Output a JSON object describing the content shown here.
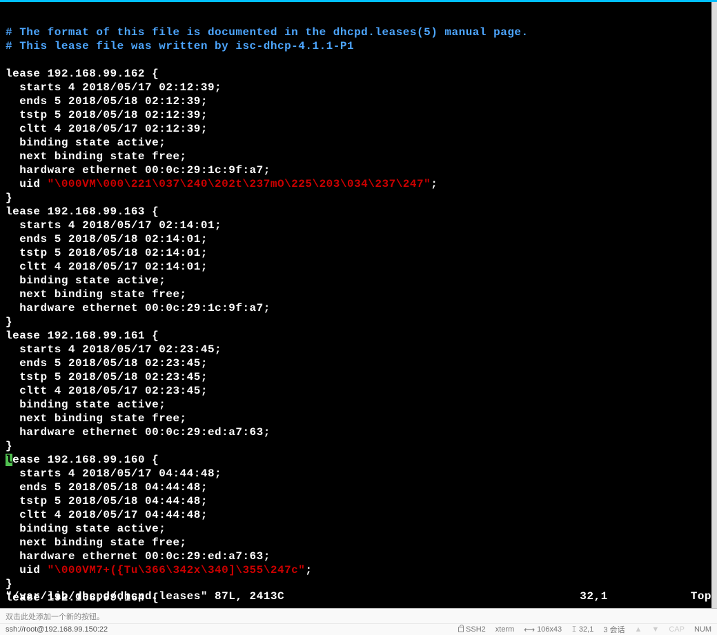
{
  "comments": {
    "line1": "# The format of this file is documented in the dhcpd.leases(5) manual page.",
    "line2": "# This lease file was written by isc-dhcp-4.1.1-P1"
  },
  "leases": [
    {
      "header": "lease 192.168.99.162 {",
      "starts": "  starts 4 2018/05/17 02:12:39;",
      "ends": "  ends 5 2018/05/18 02:12:39;",
      "tstp": "  tstp 5 2018/05/18 02:12:39;",
      "cltt": "  cltt 4 2018/05/17 02:12:39;",
      "binding": "  binding state active;",
      "next": "  next binding state free;",
      "hw": "  hardware ethernet 00:0c:29:1c:9f:a7;",
      "uid_prefix": "  uid ",
      "uid_val": "\"\\000VM\\000\\221\\037\\240\\202t\\237mO\\225\\203\\034\\237\\247\"",
      "uid_suffix": ";",
      "close": "}"
    },
    {
      "header": "lease 192.168.99.163 {",
      "starts": "  starts 4 2018/05/17 02:14:01;",
      "ends": "  ends 5 2018/05/18 02:14:01;",
      "tstp": "  tstp 5 2018/05/18 02:14:01;",
      "cltt": "  cltt 4 2018/05/17 02:14:01;",
      "binding": "  binding state active;",
      "next": "  next binding state free;",
      "hw": "  hardware ethernet 00:0c:29:1c:9f:a7;",
      "close": "}"
    },
    {
      "header": "lease 192.168.99.161 {",
      "starts": "  starts 4 2018/05/17 02:23:45;",
      "ends": "  ends 5 2018/05/18 02:23:45;",
      "tstp": "  tstp 5 2018/05/18 02:23:45;",
      "cltt": "  cltt 4 2018/05/17 02:23:45;",
      "binding": "  binding state active;",
      "next": "  next binding state free;",
      "hw": "  hardware ethernet 00:0c:29:ed:a7:63;",
      "close": "}"
    },
    {
      "cursor_char": "l",
      "header_rest": "ease 192.168.99.160 {",
      "starts": "  starts 4 2018/05/17 04:44:48;",
      "ends": "  ends 5 2018/05/18 04:44:48;",
      "tstp": "  tstp 5 2018/05/18 04:44:48;",
      "cltt": "  cltt 4 2018/05/17 04:44:48;",
      "binding": "  binding state active;",
      "next": "  next binding state free;",
      "hw": "  hardware ethernet 00:0c:29:ed:a7:63;",
      "uid_prefix": "  uid ",
      "uid_val": "\"\\000VM7+({Tu\\366\\342x\\340]\\355\\247c\"",
      "uid_suffix": ";",
      "close": "}"
    },
    {
      "header": "lease 192.168.99.164 {"
    }
  ],
  "vim_status": {
    "file_info": "\"/var/lib/dhcpd/dhcpd.leases\" 87L, 2413C",
    "position": "32,1",
    "scroll": "Top"
  },
  "toolbar": {
    "hint": "双击此处添加一个新的按钮。"
  },
  "statusbar": {
    "connection": "ssh://root@192.168.99.150:22",
    "ssh": "SSH2",
    "term": "xterm",
    "size": "106x43",
    "pos": "32,1",
    "sessions": "3 会话",
    "cap": "CAP",
    "num": "NUM"
  }
}
